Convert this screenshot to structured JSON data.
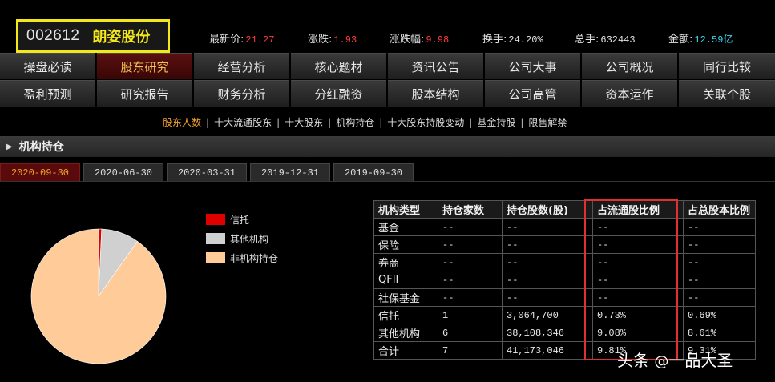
{
  "stock": {
    "code": "002612",
    "name": "朗姿股份",
    "quotes": [
      {
        "label": "最新价:",
        "value": "21.27",
        "color": "#ff3b3b"
      },
      {
        "label": "涨跌:",
        "value": "1.93",
        "color": "#ff3b3b"
      },
      {
        "label": "涨跌幅:",
        "value": "9.98",
        "color": "#ff3b3b"
      },
      {
        "label": "换手:",
        "value": "24.20%",
        "color": "#e0e0e0"
      },
      {
        "label": "总手:",
        "value": "632443",
        "color": "#e0e0e0"
      },
      {
        "label": "金额:",
        "value": "12.59亿",
        "color": "#36d8ee"
      }
    ]
  },
  "nav": {
    "row1": [
      "操盘必读",
      "股东研究",
      "经营分析",
      "核心题材",
      "资讯公告",
      "公司大事",
      "公司概况",
      "同行比较"
    ],
    "row2": [
      "盈利预测",
      "研究报告",
      "财务分析",
      "分红融资",
      "股本结构",
      "公司高管",
      "资本运作",
      "关联个股"
    ],
    "active": "股东研究"
  },
  "sub_nav": {
    "items": [
      "股东人数",
      "十大流通股东",
      "十大股东",
      "机构持仓",
      "十大股东持股变动",
      "基金持股",
      "限售解禁"
    ],
    "separator": "|"
  },
  "section": {
    "title": "机构持仓",
    "arrow": "▶"
  },
  "date_tabs": [
    "2020-09-30",
    "2020-06-30",
    "2020-03-31",
    "2019-12-31",
    "2019-09-30"
  ],
  "legend": [
    {
      "label": "信托",
      "color": "#e00000"
    },
    {
      "label": "其他机构",
      "color": "#d0d0d0"
    },
    {
      "label": "非机构持仓",
      "color": "#ffcc99"
    }
  ],
  "chart_data": {
    "type": "pie",
    "slices": [
      {
        "name": "信托",
        "value": 0.73,
        "color": "#e00000"
      },
      {
        "name": "其他机构",
        "value": 9.08,
        "color": "#d0d0d0"
      },
      {
        "name": "非机构持仓",
        "value": 90.19,
        "color": "#ffcc99"
      }
    ]
  },
  "table": {
    "headers": [
      "机构类型",
      "持仓家数",
      "持仓股数(股)",
      "占流通股比例",
      "占总股本比例"
    ],
    "rows": [
      [
        "基金",
        "--",
        "--",
        "--",
        "--"
      ],
      [
        "保险",
        "--",
        "--",
        "--",
        "--"
      ],
      [
        "券商",
        "--",
        "--",
        "--",
        "--"
      ],
      [
        "QFII",
        "--",
        "--",
        "--",
        "--"
      ],
      [
        "社保基金",
        "--",
        "--",
        "--",
        "--"
      ],
      [
        "信托",
        "1",
        "3,064,700",
        "0.73%",
        "0.69%"
      ],
      [
        "其他机构",
        "6",
        "38,108,346",
        "9.08%",
        "8.61%"
      ],
      [
        "合计",
        "7",
        "41,173,046",
        "9.81%",
        "9.31%"
      ]
    ]
  },
  "watermark": {
    "prefix": "头条 ",
    "at": "@",
    "name": "一品大圣"
  }
}
